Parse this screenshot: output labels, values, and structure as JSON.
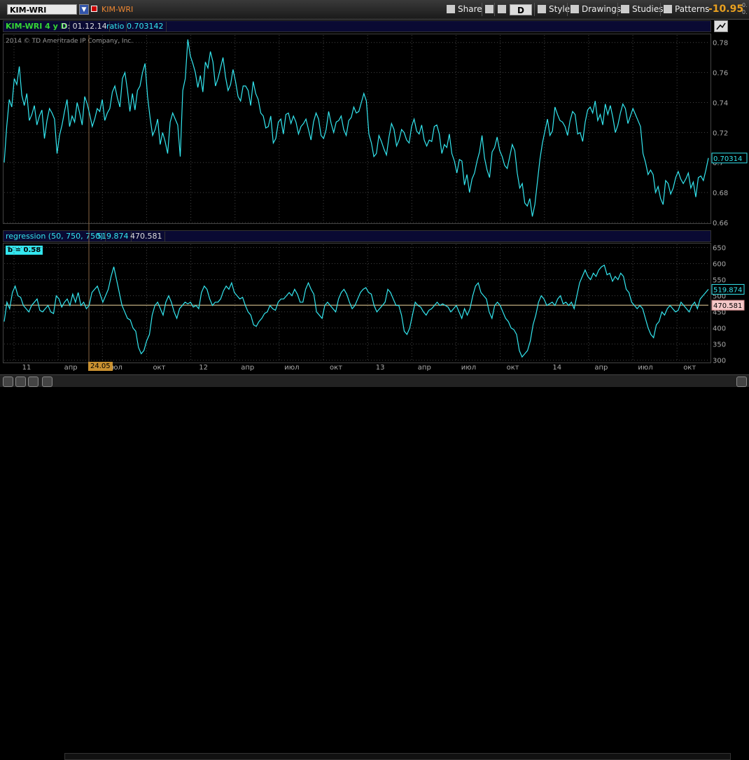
{
  "toolbar": {
    "symbol": "KIM-WRI",
    "symbol_secondary": "KIM-WRI",
    "share": "Share",
    "period": "D",
    "style": "Style",
    "drawings": "Drawings",
    "studies": "Studies",
    "patterns": "Patterns",
    "price_change": "-10.95",
    "tiny_top": "0.",
    "tiny_bot": "0."
  },
  "info": {
    "title": "KIM-WRI 4 y D",
    "date": "D: 01.12.14",
    "ratio_label": "ratio",
    "ratio_value": "0.703142"
  },
  "copyright": "2014 © TD Ameritrade IP Company, Inc.",
  "regression": {
    "label": "regression (50, 750, 750)",
    "value1": "519.874",
    "value2": "470.581",
    "b_label": "b = 0.58"
  },
  "colors": {
    "series": "#33e6ef",
    "hline": "#f0d8a0",
    "accent": "#e8a020"
  },
  "date_badge": "24.05",
  "chart_data": [
    {
      "type": "line",
      "ylim": [
        0.66,
        0.785
      ],
      "yticks": [
        "0.78",
        "0.76",
        "0.74",
        "0.72",
        "0.7",
        "0.68",
        "0.66"
      ],
      "last_label": "0.70314",
      "xlabels": [
        "11",
        "апр",
        "июл",
        "окт",
        "12",
        "апр",
        "июл",
        "окт",
        "13",
        "апр",
        "июл",
        "окт",
        "14",
        "апр",
        "июл",
        "окт"
      ],
      "series": [
        {
          "values": [
            0.7,
            0.724,
            0.742,
            0.737,
            0.756,
            0.752,
            0.764,
            0.745,
            0.738,
            0.746,
            0.728,
            0.732,
            0.738,
            0.725,
            0.731,
            0.735,
            0.716,
            0.728,
            0.736,
            0.733,
            0.729,
            0.706,
            0.718,
            0.725,
            0.734,
            0.742,
            0.724,
            0.731,
            0.727,
            0.74,
            0.733,
            0.725,
            0.744,
            0.739,
            0.732,
            0.724,
            0.729,
            0.736,
            0.734,
            0.742,
            0.728,
            0.733,
            0.736,
            0.747,
            0.751,
            0.743,
            0.737,
            0.756,
            0.76,
            0.748,
            0.734,
            0.746,
            0.735,
            0.748,
            0.751,
            0.76,
            0.766,
            0.744,
            0.73,
            0.718,
            0.722,
            0.729,
            0.712,
            0.72,
            0.714,
            0.706,
            0.727,
            0.733,
            0.729,
            0.725,
            0.704,
            0.748,
            0.756,
            0.782,
            0.771,
            0.766,
            0.76,
            0.75,
            0.758,
            0.747,
            0.767,
            0.763,
            0.774,
            0.767,
            0.751,
            0.756,
            0.763,
            0.77,
            0.757,
            0.748,
            0.752,
            0.762,
            0.754,
            0.744,
            0.741,
            0.751,
            0.751,
            0.748,
            0.738,
            0.754,
            0.746,
            0.742,
            0.733,
            0.731,
            0.723,
            0.724,
            0.731,
            0.713,
            0.716,
            0.727,
            0.729,
            0.719,
            0.732,
            0.733,
            0.726,
            0.731,
            0.727,
            0.719,
            0.724,
            0.726,
            0.729,
            0.722,
            0.715,
            0.727,
            0.733,
            0.729,
            0.718,
            0.716,
            0.722,
            0.734,
            0.726,
            0.72,
            0.727,
            0.728,
            0.731,
            0.722,
            0.718,
            0.728,
            0.73,
            0.737,
            0.733,
            0.734,
            0.74,
            0.746,
            0.741,
            0.719,
            0.713,
            0.704,
            0.706,
            0.718,
            0.714,
            0.709,
            0.705,
            0.717,
            0.726,
            0.722,
            0.711,
            0.715,
            0.722,
            0.72,
            0.715,
            0.713,
            0.724,
            0.729,
            0.721,
            0.719,
            0.725,
            0.715,
            0.711,
            0.715,
            0.714,
            0.724,
            0.725,
            0.719,
            0.706,
            0.712,
            0.71,
            0.719,
            0.706,
            0.701,
            0.693,
            0.702,
            0.701,
            0.685,
            0.692,
            0.68,
            0.689,
            0.693,
            0.701,
            0.707,
            0.718,
            0.703,
            0.695,
            0.69,
            0.707,
            0.71,
            0.717,
            0.708,
            0.704,
            0.698,
            0.696,
            0.704,
            0.712,
            0.708,
            0.693,
            0.683,
            0.686,
            0.673,
            0.671,
            0.676,
            0.664,
            0.672,
            0.687,
            0.702,
            0.713,
            0.721,
            0.729,
            0.718,
            0.721,
            0.737,
            0.732,
            0.728,
            0.727,
            0.724,
            0.718,
            0.728,
            0.734,
            0.732,
            0.719,
            0.72,
            0.714,
            0.727,
            0.735,
            0.737,
            0.733,
            0.741,
            0.728,
            0.732,
            0.725,
            0.739,
            0.732,
            0.738,
            0.73,
            0.72,
            0.725,
            0.733,
            0.739,
            0.736,
            0.726,
            0.731,
            0.736,
            0.732,
            0.728,
            0.724,
            0.706,
            0.7,
            0.692,
            0.695,
            0.692,
            0.68,
            0.684,
            0.676,
            0.672,
            0.688,
            0.686,
            0.679,
            0.683,
            0.69,
            0.694,
            0.689,
            0.686,
            0.689,
            0.693,
            0.683,
            0.687,
            0.677,
            0.69,
            0.691,
            0.688,
            0.695,
            0.703
          ]
        }
      ]
    },
    {
      "type": "line",
      "ylim": [
        295,
        660
      ],
      "yticks": [
        "650",
        "600",
        "550",
        "500",
        "450",
        "400",
        "350",
        "300"
      ],
      "hline": 470.581,
      "last_labels": [
        "519.874",
        "470.581"
      ],
      "series": [
        {
          "values": [
            420,
            480,
            460,
            510,
            530,
            500,
            495,
            470,
            460,
            450,
            470,
            480,
            490,
            455,
            450,
            460,
            470,
            450,
            445,
            500,
            490,
            465,
            480,
            490,
            470,
            505,
            480,
            510,
            470,
            480,
            460,
            470,
            510,
            520,
            530,
            505,
            480,
            500,
            520,
            560,
            590,
            550,
            510,
            470,
            450,
            430,
            425,
            400,
            390,
            340,
            320,
            330,
            360,
            380,
            440,
            470,
            480,
            460,
            440,
            480,
            500,
            480,
            450,
            430,
            460,
            470,
            480,
            475,
            480,
            465,
            470,
            460,
            510,
            530,
            520,
            490,
            470,
            480,
            480,
            490,
            515,
            530,
            520,
            540,
            510,
            500,
            490,
            495,
            470,
            450,
            440,
            410,
            405,
            420,
            430,
            445,
            450,
            470,
            460,
            455,
            480,
            490,
            490,
            500,
            510,
            500,
            520,
            505,
            480,
            480,
            520,
            540,
            520,
            505,
            450,
            440,
            430,
            470,
            480,
            470,
            460,
            450,
            490,
            510,
            520,
            505,
            480,
            460,
            470,
            490,
            510,
            520,
            525,
            510,
            505,
            470,
            450,
            460,
            470,
            480,
            520,
            510,
            490,
            470,
            470,
            440,
            390,
            380,
            400,
            440,
            480,
            470,
            465,
            450,
            440,
            455,
            460,
            470,
            480,
            470,
            475,
            470,
            465,
            450,
            460,
            470,
            450,
            430,
            460,
            440,
            460,
            500,
            530,
            540,
            510,
            500,
            490,
            450,
            430,
            470,
            480,
            470,
            450,
            430,
            420,
            400,
            395,
            380,
            330,
            310,
            320,
            330,
            360,
            410,
            440,
            480,
            500,
            490,
            470,
            475,
            480,
            470,
            490,
            500,
            475,
            480,
            470,
            480,
            460,
            500,
            540,
            560,
            580,
            560,
            550,
            570,
            560,
            580,
            590,
            595,
            565,
            570,
            545,
            560,
            550,
            570,
            560,
            520,
            510,
            480,
            470,
            460,
            470,
            460,
            430,
            400,
            380,
            370,
            410,
            420,
            450,
            440,
            460,
            470,
            460,
            450,
            455,
            480,
            470,
            460,
            450,
            470,
            480,
            460,
            490,
            500,
            510,
            520
          ]
        }
      ]
    }
  ]
}
